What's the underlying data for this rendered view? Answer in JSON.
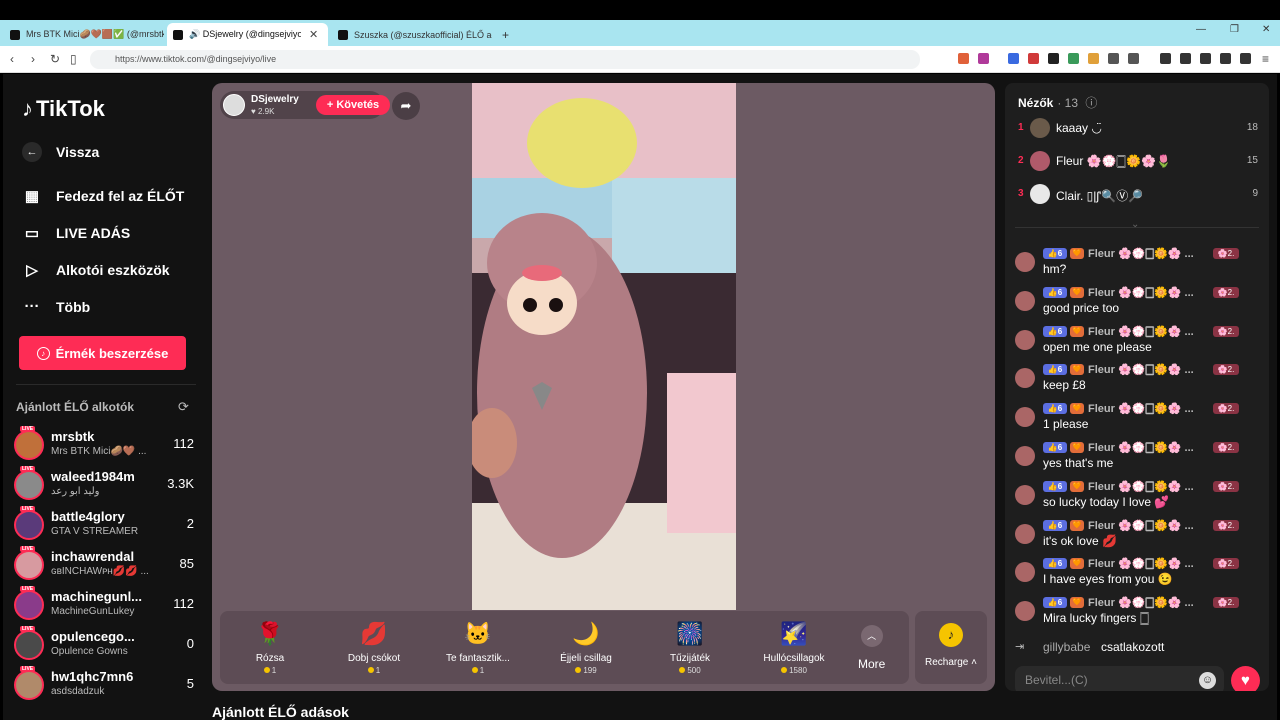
{
  "browser": {
    "tabs": [
      {
        "label": "Mrs BTK Mici🥔🤎🟫✅ (@mrsbtk) ..."
      },
      {
        "label": "🔊 DSjewelry (@dingsejviyo) ÉLŐ"
      },
      {
        "label": "Szuszka (@szuszkaofficial) ÉLŐ adás..."
      }
    ],
    "url": "https://www.tiktok.com/@dingsejviyo/live",
    "new_tab": "+",
    "close": "✕"
  },
  "sidebar": {
    "logo": "TikTok",
    "back": "Vissza",
    "nav": [
      {
        "label": "Fedezd fel az ÉLŐT",
        "icon": "calendar-icon"
      },
      {
        "label": "LIVE ADÁS",
        "icon": "video-camera-icon"
      },
      {
        "label": "Alkotói eszközök",
        "icon": "play-icon"
      },
      {
        "label": "Több",
        "icon": "more-icon"
      }
    ],
    "coins_button": "Érmék beszerzése",
    "recommended_title": "Ajánlott ÉLŐ alkotók",
    "live_badge": "LIVE",
    "creators": [
      {
        "name": "mrsbtk",
        "sub": "Mrs BTK Mici🥔🤎 ...",
        "count": "112",
        "color": "#c0703a"
      },
      {
        "name": "waleed1984m",
        "sub": "وليد ابو رعد",
        "count": "3.3K",
        "color": "#8a8a8a"
      },
      {
        "name": "battle4glory",
        "sub": "GTA V STREAMER",
        "count": "2",
        "color": "#5a3a7a"
      },
      {
        "name": "inchawrendal",
        "sub": "ɢʙINCHAWᴘʜ💋💋 ...",
        "count": "85",
        "color": "#d79aa0"
      },
      {
        "name": "machinegunl...",
        "sub": "MachineGunLukey",
        "count": "112",
        "color": "#8a3b8a"
      },
      {
        "name": "opulencego...",
        "sub": "Opulence Gowns",
        "count": "0",
        "color": "#4a4a4a"
      },
      {
        "name": "hw1qhc7mn6",
        "sub": "asdsdadzuk",
        "count": "5",
        "color": "#b08a6a"
      }
    ]
  },
  "host": {
    "name": "DSjewelry",
    "likes": "♥ 2.9K",
    "follow": "+ Követés"
  },
  "gifts": [
    {
      "name": "Rózsa",
      "price": "1",
      "icon": "🌹"
    },
    {
      "name": "Dobj csókot",
      "price": "1",
      "icon": "💋"
    },
    {
      "name": "Te fantasztik...",
      "price": "1",
      "icon": "🐱"
    },
    {
      "name": "Éjjeli csillag",
      "price": "199",
      "icon": "🌙"
    },
    {
      "name": "Tűzijáték",
      "price": "500",
      "icon": "🎆"
    },
    {
      "name": "Hullócsillagok",
      "price": "1580",
      "icon": "🌠"
    }
  ],
  "more_label": "More",
  "recharge_label": "Recharge",
  "footer_title": "Ajánlott ÉLŐ adások",
  "viewers": {
    "title": "Nézők",
    "count": "· 13",
    "top": [
      {
        "rank": "1",
        "name": "kaaay ◡̈",
        "score": "18",
        "color": "#6a5a4a"
      },
      {
        "rank": "2",
        "name": "Fleur 🌸💮🀆🌼🌸🌷",
        "score": "15",
        "color": "#b05a6a"
      },
      {
        "rank": "3",
        "name": "Clair. ▯|ʃ'🔍Ⓥ🔎",
        "score": "9",
        "color": "#e8e8e8"
      }
    ]
  },
  "chat": {
    "level": "👍6",
    "badge": "🧡",
    "user": "Fleur 🌸💮🀆🌼🌸 ...",
    "rank_badge": "🌸2.",
    "messages": [
      "hm?",
      "good price too",
      "open me one please",
      "keep £8",
      "1 please",
      "yes that's me",
      "so lucky today I love 💕",
      "it's ok love 💋",
      "I have eyes from you 😉",
      "Mira lucky fingers 🀆"
    ],
    "joined_user": "gillybabe",
    "joined_text": "csatlakozott",
    "input_placeholder": "Bevitel...(C)"
  }
}
